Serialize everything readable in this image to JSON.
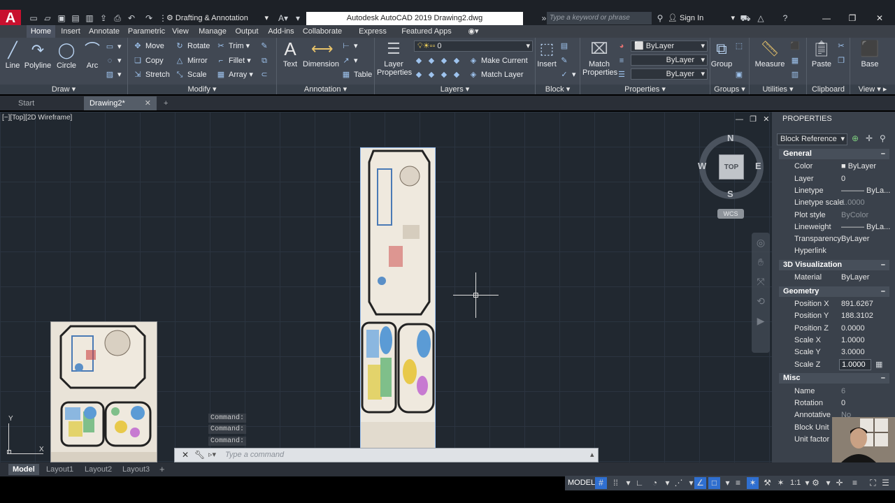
{
  "app": {
    "title": "Autodesk AutoCAD 2019    Drawing2.dwg",
    "logo_letter": "A",
    "workspace": "Drafting & Annotation",
    "search_placeholder": "Type a keyword or phrase",
    "sign_in": "Sign In"
  },
  "ribbon_tabs": [
    "Home",
    "Insert",
    "Annotate",
    "Parametric",
    "View",
    "Manage",
    "Output",
    "Add-ins",
    "Collaborate",
    "Express Tools",
    "Featured Apps"
  ],
  "draw": {
    "title": "Draw",
    "line": "Line",
    "polyline": "Polyline",
    "circle": "Circle",
    "arc": "Arc"
  },
  "modify": {
    "title": "Modify",
    "move": "Move",
    "rotate": "Rotate",
    "trim": "Trim",
    "copy": "Copy",
    "mirror": "Mirror",
    "fillet": "Fillet",
    "stretch": "Stretch",
    "scale": "Scale",
    "array": "Array"
  },
  "annotation": {
    "title": "Annotation",
    "text": "Text",
    "dimension": "Dimension",
    "table": "Table"
  },
  "layers": {
    "title": "Layers",
    "layer_properties": "Layer Properties",
    "current_layer": "0",
    "make_current": "Make Current",
    "match_layer": "Match Layer"
  },
  "block": {
    "title": "Block",
    "insert": "Insert"
  },
  "properties_panel": {
    "title": "Properties",
    "match_properties": "Match Properties",
    "color": "ByLayer",
    "linetype": "ByLayer",
    "lineweight": "ByLayer"
  },
  "groups": {
    "title": "Groups",
    "group": "Group"
  },
  "utilities": {
    "title": "Utilities",
    "measure": "Measure"
  },
  "clipboard": {
    "title": "Clipboard",
    "paste": "Paste"
  },
  "view_panel": {
    "title": "View",
    "base": "Base"
  },
  "doc_tabs": {
    "start": "Start",
    "drawing": "Drawing2*"
  },
  "viewport": {
    "label": "[−][Top][2D Wireframe]",
    "compass": {
      "n": "N",
      "s": "S",
      "e": "E",
      "w": "W",
      "top": "TOP"
    },
    "wcs": "WCS",
    "ucs_x": "X",
    "ucs_y": "Y"
  },
  "command": {
    "history": [
      "Command:",
      "Command:",
      "Command:"
    ],
    "placeholder": "Type a command"
  },
  "properties": {
    "header": "PROPERTIES",
    "selector": "Block Reference",
    "general": {
      "title": "General",
      "rows": [
        {
          "k": "Color",
          "v": "ByLayer"
        },
        {
          "k": "Layer",
          "v": "0"
        },
        {
          "k": "Linetype",
          "v": "——— ByLa..."
        },
        {
          "k": "Linetype scale",
          "v": "1.0000"
        },
        {
          "k": "Plot style",
          "v": "ByColor"
        },
        {
          "k": "Lineweight",
          "v": "——— ByLa..."
        },
        {
          "k": "Transparency",
          "v": "ByLayer"
        },
        {
          "k": "Hyperlink",
          "v": ""
        }
      ]
    },
    "visualization": {
      "title": "3D Visualization",
      "rows": [
        {
          "k": "Material",
          "v": "ByLayer"
        }
      ]
    },
    "geometry": {
      "title": "Geometry",
      "rows": [
        {
          "k": "Position X",
          "v": "891.6267"
        },
        {
          "k": "Position Y",
          "v": "188.3102"
        },
        {
          "k": "Position Z",
          "v": "0.0000"
        },
        {
          "k": "Scale X",
          "v": "1.0000"
        },
        {
          "k": "Scale Y",
          "v": "3.0000"
        },
        {
          "k": "Scale Z",
          "v": "1.0000"
        }
      ]
    },
    "misc": {
      "title": "Misc",
      "rows": [
        {
          "k": "Name",
          "v": "6"
        },
        {
          "k": "Rotation",
          "v": "0"
        },
        {
          "k": "Annotative",
          "v": "No"
        },
        {
          "k": "Block Unit",
          "v": ""
        },
        {
          "k": "Unit factor",
          "v": ""
        }
      ]
    }
  },
  "layout_tabs": {
    "model": "Model",
    "layout1": "Layout1",
    "layout2": "Layout2",
    "layout3": "Layout3"
  },
  "status": {
    "model": "MODEL",
    "scale": "1:1"
  }
}
